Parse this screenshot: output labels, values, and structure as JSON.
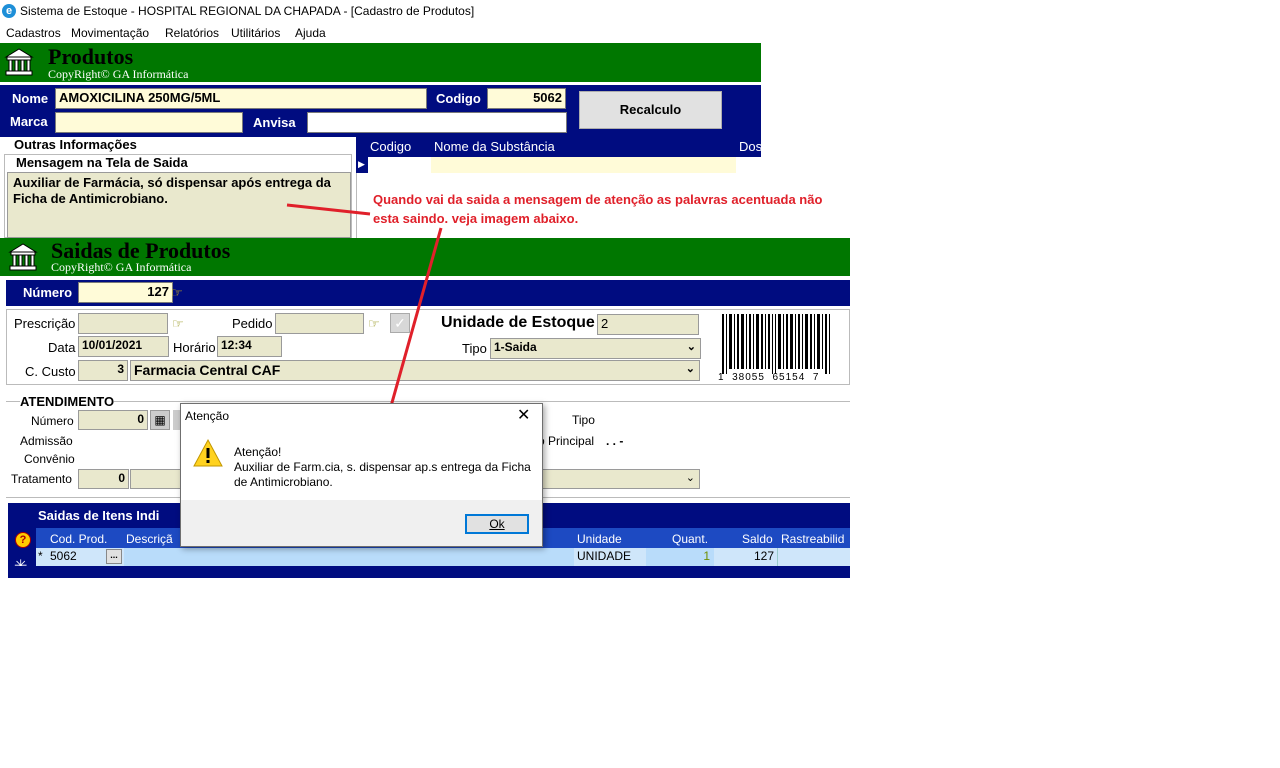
{
  "window": {
    "title": "Sistema de Estoque - HOSPITAL REGIONAL DA CHAPADA - [Cadastro de Produtos]",
    "icon": "app-logo-icon"
  },
  "menu": [
    "Cadastros",
    "Movimentação",
    "Relatórios",
    "Utilitários",
    "Ajuda"
  ],
  "produtos": {
    "header_title": "Produtos",
    "copyright": "CopyRight© GA Informática",
    "nome_label": "Nome",
    "nome_value": "AMOXICILINA 250MG/5ML",
    "codigo_label": "Codigo",
    "codigo_value": "5062",
    "marca_label": "Marca",
    "marca_value": "",
    "anvisa_label": "Anvisa",
    "anvisa_value": "",
    "recalculo_button": "Recalculo",
    "outras_info": "Outras Informações",
    "mensagem_label": "Mensagem na Tela de Saida",
    "mensagem_text": "Auxiliar de Farmácia, só dispensar após entrega da Ficha de Antimicrobiano.",
    "substancia_cols": [
      "Codigo",
      "Nome da Substância",
      "Dos"
    ]
  },
  "annotation": {
    "text": "Quando vai da saida a mensagem de atenção as palavras acentuada não esta saindo. veja imagem abaixo.",
    "color": "#e0202a"
  },
  "saidas": {
    "header_title": "Saidas de Produtos",
    "copyright": "CopyRight© GA Informática",
    "numero_label": "Número",
    "numero_value": "127",
    "prescricao_label": "Prescrição",
    "pedido_label": "Pedido",
    "unidade_estoque_label": "Unidade de Estoque",
    "unidade_estoque_value": "2",
    "data_label": "Data",
    "data_value": "10/01/2021",
    "horario_label": "Horário",
    "horario_value": "12:34",
    "tipo_label": "Tipo",
    "tipo_value": "1-Saida",
    "ccusto_label": "C. Custo",
    "ccusto_code": "3",
    "ccusto_value": "Farmacia Central CAF",
    "barcode_text": "1  38055  65154  7",
    "atendimento_label": "ATENDIMENTO",
    "at_numero_label": "Número",
    "at_numero_value": "0",
    "admissao_label": "Admissão",
    "convenio_label": "Convênio",
    "tratamento_label": "Tratamento",
    "tratamento_value": "0",
    "at_tipo_label": "Tipo",
    "principal_label": "o Principal",
    "principal_value": ". . -",
    "itens_title": "Saidas de Itens Indi",
    "grid_cols": [
      "Cod. Prod.",
      "Descriçã",
      "Unidade",
      "Quant.",
      "Saldo",
      "Rastreabilid"
    ],
    "row": {
      "marker": "*",
      "cod": "5062",
      "ellipsis": "...",
      "unidade": "UNIDADE",
      "quant": "1",
      "saldo": "127"
    }
  },
  "dialog": {
    "title": "Atenção",
    "heading": "Atenção!",
    "message": "Auxiliar de Farm.cia, s. dispensar ap.s entrega da Ficha de Antimicrobiano.",
    "ok_label": "Ok",
    "icon": "warning-icon"
  }
}
